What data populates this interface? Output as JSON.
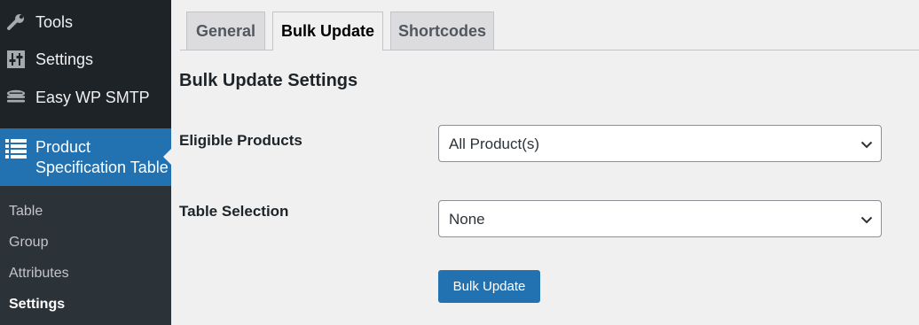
{
  "sidebar": {
    "items": [
      {
        "label": "Tools",
        "icon": "wrench-icon"
      },
      {
        "label": "Settings",
        "icon": "settings-sliders-icon"
      },
      {
        "label": "Easy WP SMTP",
        "icon": "mail-stack-icon"
      }
    ],
    "active": {
      "label_line1": "Product",
      "label_line2": "Specification Table",
      "icon": "list-icon"
    },
    "submenu": [
      {
        "label": "Table"
      },
      {
        "label": "Group"
      },
      {
        "label": "Attributes"
      },
      {
        "label": "Settings",
        "current": true
      }
    ]
  },
  "tabs": [
    {
      "label": "General"
    },
    {
      "label": "Bulk Update",
      "active": true
    },
    {
      "label": "Shortcodes"
    }
  ],
  "page": {
    "heading": "Bulk Update Settings",
    "fields": [
      {
        "label": "Eligible Products",
        "value": "All Product(s)"
      },
      {
        "label": "Table Selection",
        "value": "None"
      }
    ],
    "button_label": "Bulk Update"
  },
  "colors": {
    "sidebar_bg": "#1d2327",
    "submenu_bg": "#2c3338",
    "accent": "#2271b1",
    "page_bg": "#f0f0f1"
  }
}
